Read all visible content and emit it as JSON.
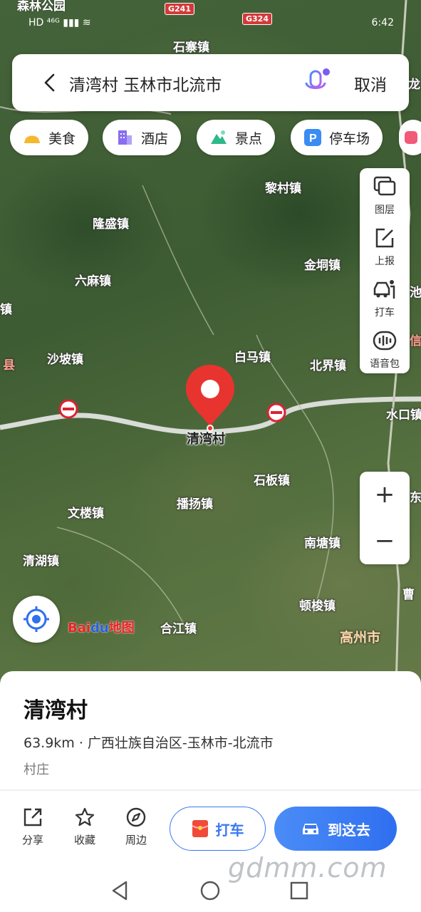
{
  "status_bar": {
    "top_fragment": "森林公园",
    "left": "HD ⁴⁶ᴳ ▮▮▮ ≋",
    "time": "6:42"
  },
  "map": {
    "places": [
      {
        "name": "石寨镇",
        "kind": "town"
      },
      {
        "name": "黎村镇",
        "kind": "town"
      },
      {
        "name": "隆盛镇",
        "kind": "town"
      },
      {
        "name": "金垌镇",
        "kind": "town"
      },
      {
        "name": "六麻镇",
        "kind": "town"
      },
      {
        "name": "镇",
        "kind": "town"
      },
      {
        "name": "白马镇",
        "kind": "town"
      },
      {
        "name": "沙坡镇",
        "kind": "town"
      },
      {
        "name": "县",
        "kind": "county"
      },
      {
        "name": "北界镇",
        "kind": "town"
      },
      {
        "name": "水口镇",
        "kind": "town"
      },
      {
        "name": "石板镇",
        "kind": "town"
      },
      {
        "name": "播扬镇",
        "kind": "town"
      },
      {
        "name": "文楼镇",
        "kind": "town"
      },
      {
        "name": "南塘镇",
        "kind": "town"
      },
      {
        "name": "清湖镇",
        "kind": "town"
      },
      {
        "name": "顿梭镇",
        "kind": "town"
      },
      {
        "name": "合江镇",
        "kind": "town"
      },
      {
        "name": "高州市",
        "kind": "city"
      },
      {
        "name": "曹",
        "kind": "town"
      },
      {
        "name": "东",
        "kind": "town"
      },
      {
        "name": "龙",
        "kind": "town"
      },
      {
        "name": "池",
        "kind": "town"
      },
      {
        "name": "信宜",
        "kind": "town"
      }
    ],
    "shields": [
      "G241",
      "G324"
    ],
    "marker_label": "清湾村",
    "logo": {
      "bai": "Bai",
      "du": "du",
      "suffix": "地图"
    }
  },
  "search": {
    "query": "清湾村 玉林市北流市",
    "cancel_label": "取消"
  },
  "chips": [
    {
      "label": "美食",
      "icon": "food-icon",
      "color": "#f5b82e"
    },
    {
      "label": "酒店",
      "icon": "hotel-icon",
      "color": "#8a6ef0"
    },
    {
      "label": "景点",
      "icon": "scenic-icon",
      "color": "#2fb88a"
    },
    {
      "label": "停车场",
      "icon": "parking-icon",
      "color": "#3a8cf2"
    }
  ],
  "tools": [
    {
      "label": "图层",
      "icon": "layers-icon"
    },
    {
      "label": "上报",
      "icon": "report-icon"
    },
    {
      "label": "打车",
      "icon": "taxi-icon"
    },
    {
      "label": "语音包",
      "icon": "voice-pack-icon"
    }
  ],
  "zoom": {
    "in": "+",
    "out": "−"
  },
  "card": {
    "title": "清湾村",
    "info": "63.9km · 广西壮族自治区-玉林市-北流市",
    "type": "村庄",
    "actions": [
      {
        "label": "分享",
        "icon": "share-icon"
      },
      {
        "label": "收藏",
        "icon": "star-icon"
      },
      {
        "label": "周边",
        "icon": "compass-icon"
      }
    ],
    "taxi_label": "打车",
    "go_label": "到这去"
  },
  "watermark": "gdmm.com",
  "accent_color": "#3a78f2"
}
